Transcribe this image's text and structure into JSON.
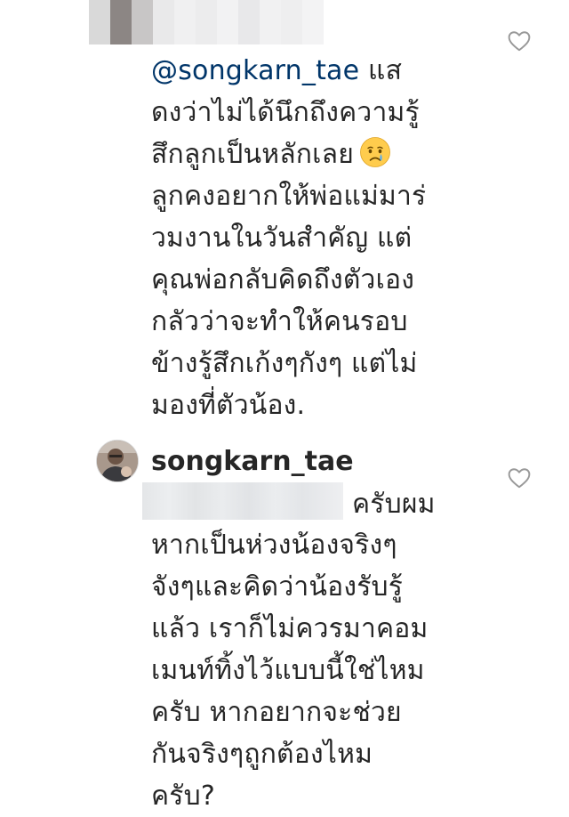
{
  "comments": [
    {
      "author_blurred": true,
      "lines": [
        {
          "mention": "@songkarn_tae",
          "text": " แส"
        },
        {
          "text": "ดงว่าไม่ได้นึกถึงความรู้"
        },
        {
          "text": "สึกลูกเป็นหลักเลย",
          "emoji": "crying-face-emoji"
        },
        {
          "text": "ลูกคงอยากให้พ่อแม่มาร่"
        },
        {
          "text": "วมงานในวันสำคัญ แต่"
        },
        {
          "text": "คุณพ่อกลับคิดถึงตัวเอง"
        },
        {
          "text": "กลัวว่าจะทำให้คนรอบ"
        },
        {
          "text": "ข้างรู้สึกเก้งๆกังๆ แต่ไม่"
        },
        {
          "text": "มองที่ตัวน้อง."
        }
      ],
      "like_icon": "heart-outline-icon"
    },
    {
      "author": "songkarn_tae",
      "avatar_icon": "user-avatar",
      "lines": [
        {
          "mention_blurred": true,
          "text": "ครับผม"
        },
        {
          "text": "หากเป็นห่วงน้องจริงๆ"
        },
        {
          "text": "จังๆและคิดว่าน้องรับรู้"
        },
        {
          "text": "แล้ว เราก็ไม่ควรมาคอม"
        },
        {
          "text": "เมนท์ทิ้งไว้แบบนี้ใช่ไหม"
        },
        {
          "text": "ครับ หากอยากจะช่วย"
        },
        {
          "text": "กันจริงๆถูกต้องไหม"
        },
        {
          "text": "ครับ?"
        }
      ],
      "like_icon": "heart-outline-icon"
    }
  ],
  "colors": {
    "text": "#262626",
    "mention": "#003569",
    "icon": "#999999"
  }
}
